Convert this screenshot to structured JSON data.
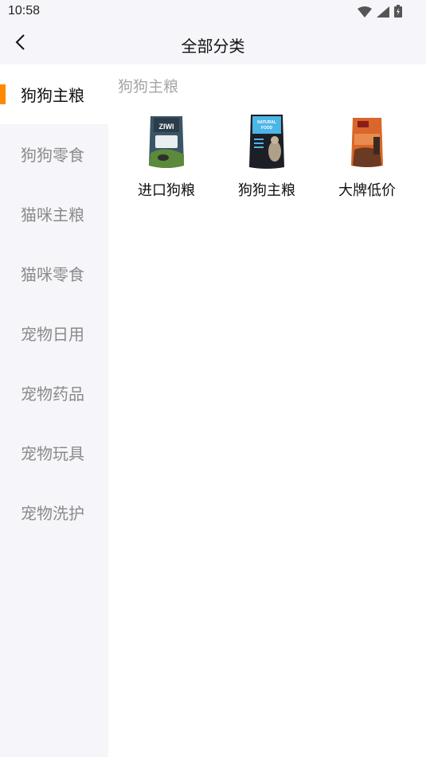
{
  "status_bar": {
    "time": "10:58"
  },
  "header": {
    "title": "全部分类"
  },
  "sidebar": {
    "items": [
      {
        "label": "狗狗主粮",
        "active": true
      },
      {
        "label": "狗狗零食",
        "active": false
      },
      {
        "label": "猫咪主粮",
        "active": false
      },
      {
        "label": "猫咪零食",
        "active": false
      },
      {
        "label": "宠物日用",
        "active": false
      },
      {
        "label": "宠物药品",
        "active": false
      },
      {
        "label": "宠物玩具",
        "active": false
      },
      {
        "label": "宠物洗护",
        "active": false
      }
    ]
  },
  "main": {
    "section_title": "狗狗主粮",
    "categories": [
      {
        "label": "进口狗粮",
        "icon": "zeal-dog-food-bag-image"
      },
      {
        "label": "狗狗主粮",
        "icon": "natural-dog-food-bag-image"
      },
      {
        "label": "大牌低价",
        "icon": "orijen-cat-food-bag-image"
      }
    ]
  },
  "colors": {
    "accent": "#ff8a00",
    "sidebar_bg": "#f6f6fa",
    "inactive_text": "#8a8a8a",
    "section_title": "#a6a6a6"
  }
}
